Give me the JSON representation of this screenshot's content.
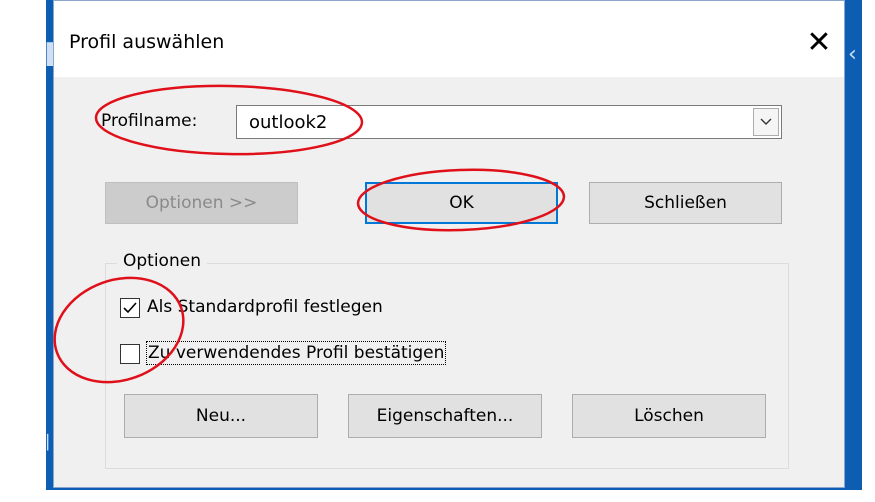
{
  "dialog": {
    "title": "Profil auswählen",
    "close_glyph": "✕"
  },
  "profile": {
    "label": "Profilname:",
    "value": "outlook2"
  },
  "buttons": {
    "options": "Optionen >>",
    "ok": "OK",
    "close": "Schließen"
  },
  "options_group": {
    "label": "Optionen",
    "checkbox_default": {
      "label": "Als Standardprofil festlegen",
      "checked": true
    },
    "checkbox_confirm": {
      "label": "Zu verwendendes Profil bestätigen",
      "checked": false
    },
    "new": "Neu...",
    "properties": "Eigenschaften...",
    "delete": "Löschen"
  },
  "colors": {
    "annotation": "#e0101a",
    "accent": "#0078d7"
  }
}
